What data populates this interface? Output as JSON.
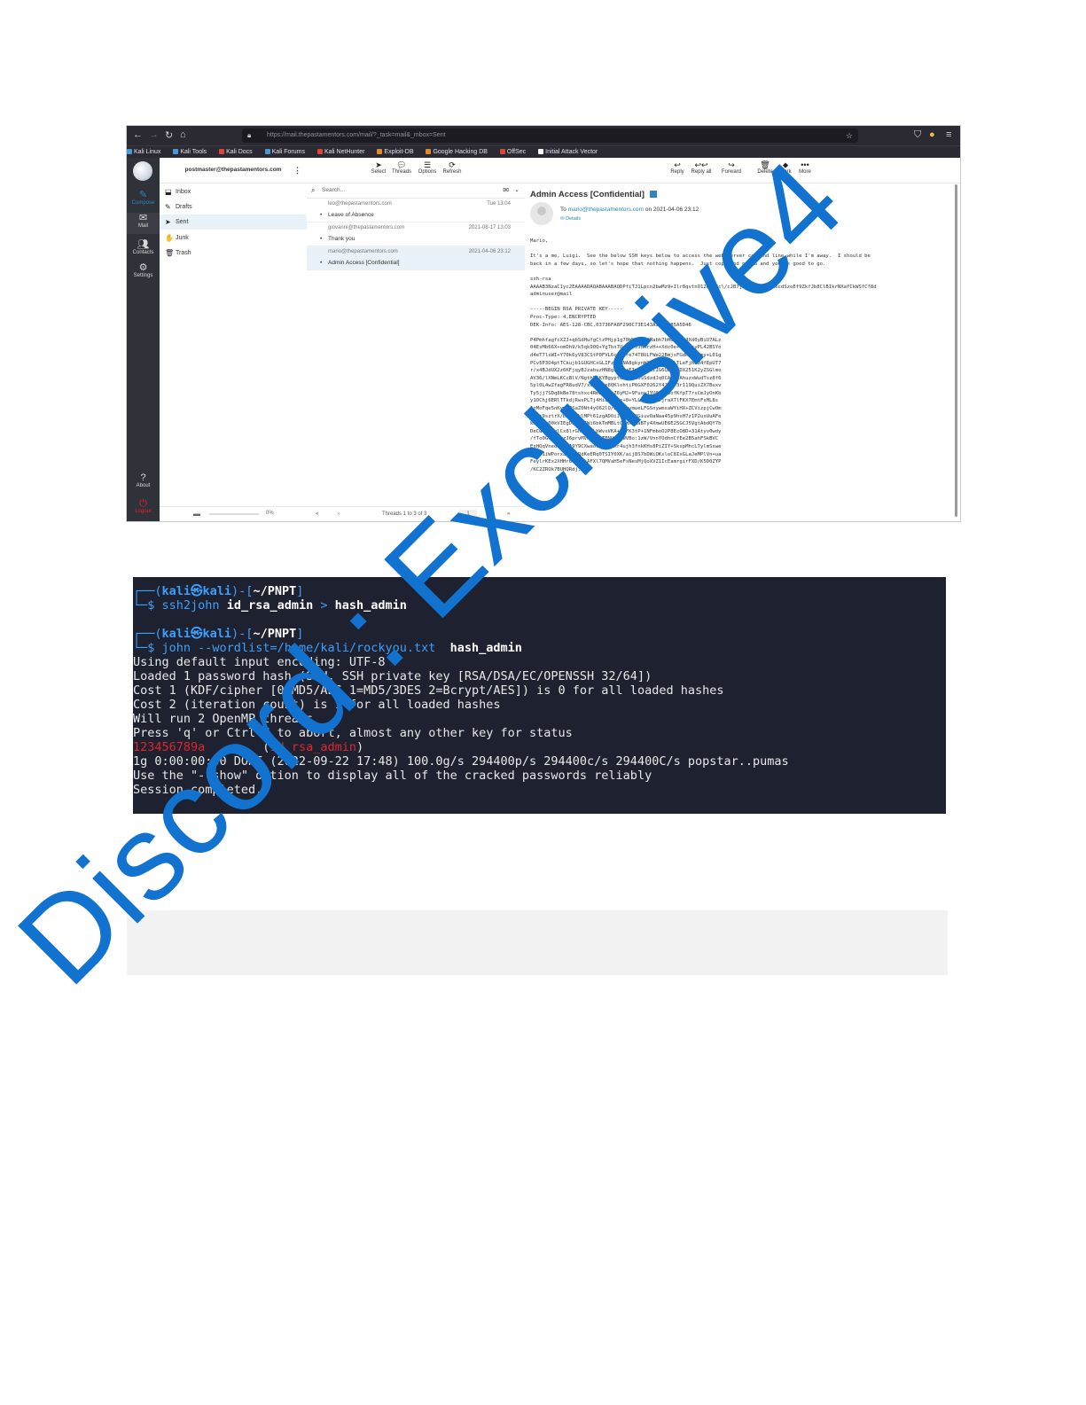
{
  "browser": {
    "url": "https://mail.thepastamentors.com/mail/?_task=mail&_mbox=Sent",
    "bookmarks": [
      "Kali Linux",
      "Kali Tools",
      "Kali Docs",
      "Kali Forums",
      "Kali NetHunter",
      "Exploit-DB",
      "Google Hacking DB",
      "OffSec",
      "Initial Attack Vector"
    ]
  },
  "webmail": {
    "account": "postmaster@thepastamentors.com",
    "rail": [
      "Compose",
      "Mail",
      "Contacts",
      "Settings",
      "About",
      "Logout"
    ],
    "folders": [
      "Inbox",
      "Drafts",
      "Sent",
      "Junk",
      "Trash"
    ],
    "list_tools": [
      "Select",
      "Threads",
      "Options",
      "Refresh"
    ],
    "search_placeholder": "Search...",
    "messages": [
      {
        "from": "leo@thepastamentors.com",
        "date": "Tue 13:04",
        "subject": "Leave of Absence"
      },
      {
        "from": "giovanni@thepastamentors.com",
        "date": "2021-08-17 13:03",
        "subject": "Thank you"
      },
      {
        "from": "mario@thepastamentors.com",
        "date": "2021-04-06 23:12",
        "subject": "Admin Access [Confidential]"
      }
    ],
    "list_footer": "Threads 1 to 3 of 3",
    "page_number": "1",
    "quota": "0%",
    "reader_tools": [
      "Reply",
      "Reply all",
      "Forward",
      "Delete",
      "Mark",
      "More"
    ],
    "reader": {
      "subject": "Admin Access [Confidential]",
      "to_prefix": "To",
      "to_address": "mario@thepastamentors.com",
      "to_date": "on 2021-04-06 23:12",
      "details": "Details",
      "body": "Mario,\n\nIt's a me, Luigi.  See the below SSH keys below to access the web server command line while I'm away.  I should be\nback in a few days, so let's hope that nothing happens.  Just copy and pasta and you're good to go.\n\nssh-rsa\nAAAAB3NzaC1yc2EAAAADAQABAAABAQDPfiTJ1Lpcn2bwMz9+Ilr8qvtnO12HfbFc\\/cJB7jqwlCSKSCyYn6cdSzoEf9ZkfJb8ClBIkrNXafCkWSfCf8d\nadminuser@mail\n\n-----BEGIN RSA PRIVATE KEY-----\nProc-Type: 4,ENCRYPTED\nDEK-Info: AES-128-CBC,03736FA8F290C73E143A3C1E385A5D46\n\nP4PmhfagfcXZJ+qbSdHufgCtzPHjp1g70WKIND1fMabh7bHGjFis4Xd0yBiU7ALz\n04EsMb66X+omDh9/k5qk90Q+YgTbx7UojMTlJGRrzH++Xdc0e+tBCCsyPL42BSYo\nd4eT7lsWI+Y70k6yV83CStP0FVL6c1LLre74T8ULFWe22BmjsFGdR8fllmy+L01g\nPCv5P3O4ptTCkujb1GUGHCxGLIFzav3NA8gkynW113xlTkMCLTLeFjH8B4fEpUT7\nr/x4BJdUX2z6KFjqyBJzabuzHN8gkydv+EImb/8cwlIG6QD5EjDX251K2yZSGlmo\nAV36/lXNmLKCcBlV/NgthE1KYBgypteMoyYK0SSdzdJq0CAKzFAhuzxWudTsz8f6\n5pl0L4wZfagFR8udV7/xvw3pxe8QKlohtiP6GXF0262Y4JzX73r119QuiZX7Buxv\nTy5jj7SDq8kBe78tshxc4Rm8r6uoZ6yMJ+9FuoyJYU0QLs5ofKfpT7rsCmJyOnKb\ny1OChj6ERlTTkdjRwsPLTj4Hi8GDQOs+0+YLLbijOeIzjraX7lFKX7EmtFsHL8s\n1zMoFqe5nKywTOSaZ0Nt4yO62lQ/L8oZyvmueLFGSoywmsaWYiHX+ZCVizpjCwOm\n66Uj9sztrX/Dm4uvklMPt61zgADOiJ4iu+NVGiuvOaNaa45p9hxH7z1P2usUuAFe\nkRpfIz00kVIEgDSul2EWi6bkTmMBLtCmWXgRaBTy4XmwUE6E25GCJ5VgtAbdQY7b\nDeCwcqjcvlCx8lrGh/PsULbWvxVKA+AOFK3tP+1NFmboO2P8EcO8D+31Atyv0wdy\n/fTo0G778vyzJ6prvMVHR3thTBNVfVZWVBo:1zW/VnnYOdhnCfEe2B5ahFSkBVC\nEsHQqVnedoGhLA9Y9CXwaovn8nrCXr4ujh3fnkKHs8PiZIY+SkspMhcL7ylmSswe\nJ0U91iWPorxahGjmRdKeERq0TSIY0XK/aij8S7bDWiOKsloC8IxGLaJeMPlVn+ua\nFeylrKEx2XHHr8GFU4kAFXl7QMVaH5eFsNesMjQoXVZ1IcEamrgirFXD/K5D0ZYP\n/KC2ZROk7BUHQRdj..."
    }
  },
  "terminal": {
    "prompt1_user": "kali",
    "prompt1_at": "㉿",
    "prompt1_host": "kali",
    "prompt1_path": "~/PNPT",
    "cmd1_tool": "ssh2john",
    "cmd1_arg": "id_rsa_admin",
    "cmd1_redirect": ">",
    "cmd1_out": "hash_admin",
    "prompt2_user": "kali",
    "prompt2_at": "㉿",
    "prompt2_host": "kali",
    "prompt2_path": "~/PNPT",
    "cmd2_tool": "john",
    "cmd2_opt": "--wordlist=/home/kali/rockyou.txt",
    "cmd2_file": "hash_admin",
    "output": [
      "Using default input encoding: UTF-8",
      "Loaded 1 password hash (SSH, SSH private key [RSA/DSA/EC/OPENSSH 32/64])",
      "Cost 1 (KDF/cipher [0=MD5/AES 1=MD5/3DES 2=Bcrypt/AES]) is 0 for all loaded hashes",
      "Cost 2 (iteration count) is 1 for all loaded hashes",
      "Will run 2 OpenMP threads",
      "Press 'q' or Ctrl-C to abort, almost any other key for status"
    ],
    "cracked_password": "123456789a",
    "cracked_file": "id_rsa_admin",
    "status_line": "1g 0:00:00:00 DONE (2022-09-22 17:48) 100.0g/s 294400p/s 294400c/s 294400C/s popstar..pumas",
    "show_hint": "Use the \"--show\" option to display all of the cracked passwords reliably",
    "completed": "Session completed."
  },
  "watermark": "Discord : Exclusive4"
}
